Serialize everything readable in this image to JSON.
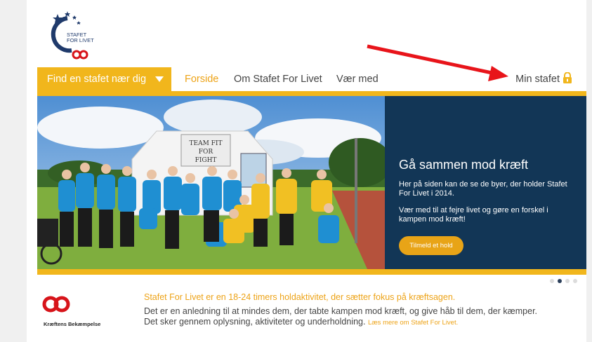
{
  "logo": {
    "line1": "STAFET",
    "line2": "FOR LIVET"
  },
  "nav": {
    "find_label": "Find en stafet nær dig",
    "links": [
      "Forside",
      "Om Stafet For Livet",
      "Vær med"
    ],
    "min_stafet": "Min stafet"
  },
  "hero": {
    "sign_text": "TEAM FIT FOR FIGHT",
    "title": "Gå sammen mod kræft",
    "text1": "Her på siden kan de se de byer, der holder Stafet For Livet i 2014.",
    "text2": "Vær med til at fejre livet og gøre en forskel i kampen mod kræft!",
    "cta": "Tilmeld et hold"
  },
  "carousel": {
    "count": 4,
    "active": 2
  },
  "partner": {
    "name": "Kræftens Bekæmpelse"
  },
  "intro": {
    "headline": "Stafet For Livet er en 18-24 timers holdaktivitet, der sætter fokus på kræftsagen.",
    "line1": "Det er en anledning til at mindes dem, der tabte kampen mod kræft, og give håb til dem, der kæmper.",
    "line2": "Det sker gennem oplysning, aktiviteter og underholdning.",
    "read_more": "Læs mere om Stafet For Livet."
  },
  "colors": {
    "accent": "#f1b61c",
    "navy": "#123656",
    "brand_red": "#d7141a",
    "annotation_arrow": "#e8141a"
  }
}
